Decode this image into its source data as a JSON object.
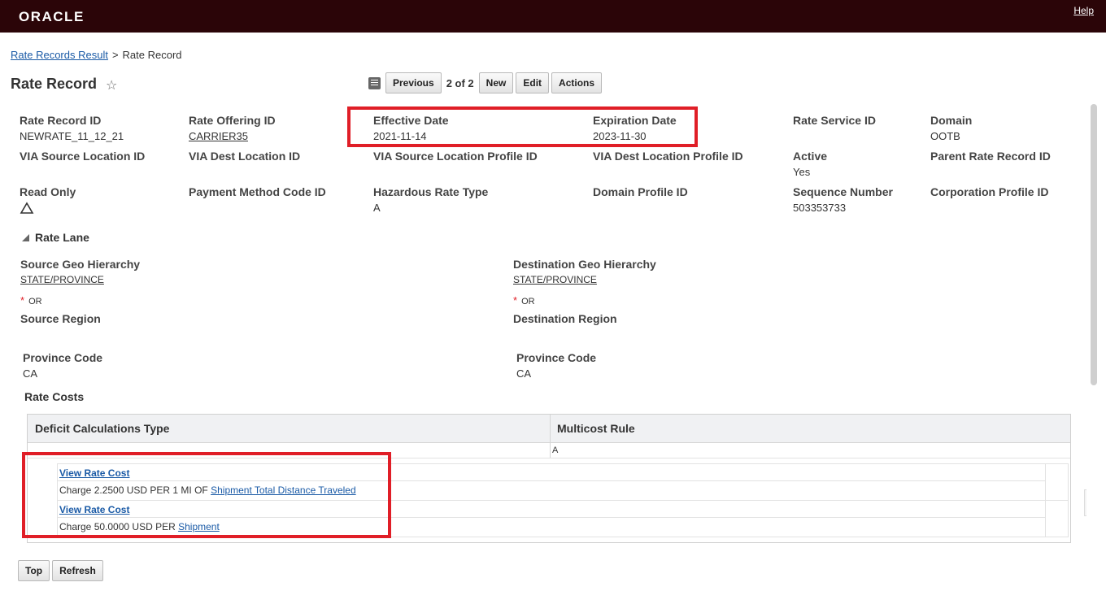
{
  "header": {
    "logo": "ORACLE",
    "help": "Help"
  },
  "breadcrumb": {
    "link": "Rate Records Result",
    "separator": ">",
    "current": "Rate Record"
  },
  "page": {
    "title": "Rate Record",
    "star": "☆"
  },
  "toolbar": {
    "previous": "Previous",
    "count": "2 of 2",
    "new": "New",
    "edit": "Edit",
    "actions": "Actions"
  },
  "fields": {
    "rate_record_id": {
      "label": "Rate Record ID",
      "value": "NEWRATE_11_12_21"
    },
    "rate_offering_id": {
      "label": "Rate Offering ID",
      "value": "CARRIER35"
    },
    "effective_date": {
      "label": "Effective Date",
      "value": "2021-11-14"
    },
    "expiration_date": {
      "label": "Expiration Date",
      "value": "2023-11-30"
    },
    "rate_service_id": {
      "label": "Rate Service ID",
      "value": ""
    },
    "domain": {
      "label": "Domain",
      "value": "OOTB"
    },
    "via_source_location_id": {
      "label": "VIA Source Location ID",
      "value": ""
    },
    "via_dest_location_id": {
      "label": "VIA Dest Location ID",
      "value": ""
    },
    "via_source_location_profile_id": {
      "label": "VIA Source Location Profile ID",
      "value": ""
    },
    "via_dest_location_profile_id": {
      "label": "VIA Dest Location Profile ID",
      "value": ""
    },
    "active": {
      "label": "Active",
      "value": "Yes"
    },
    "parent_rate_record_id": {
      "label": "Parent Rate Record ID",
      "value": ""
    },
    "read_only": {
      "label": "Read Only",
      "value": "",
      "icon": "triangle-outline-icon"
    },
    "payment_method_code_id": {
      "label": "Payment Method Code ID",
      "value": ""
    },
    "hazardous_rate_type": {
      "label": "Hazardous Rate Type",
      "value": "A"
    },
    "domain_profile_id": {
      "label": "Domain Profile ID",
      "value": ""
    },
    "sequence_number": {
      "label": "Sequence Number",
      "value": "503353733"
    },
    "corporation_profile_id": {
      "label": "Corporation Profile ID",
      "value": ""
    }
  },
  "rate_lane": {
    "title": "Rate Lane",
    "source_geo_hierarchy": {
      "label": "Source Geo Hierarchy",
      "value": "STATE/PROVINCE"
    },
    "destination_geo_hierarchy": {
      "label": "Destination Geo Hierarchy",
      "value": "STATE/PROVINCE"
    },
    "or_text": "OR",
    "source_region": {
      "label": "Source Region"
    },
    "destination_region": {
      "label": "Destination Region"
    },
    "source_province_code": {
      "label": "Province Code",
      "value": "CA"
    },
    "destination_province_code": {
      "label": "Province Code",
      "value": "CA"
    }
  },
  "rate_costs": {
    "title": "Rate Costs",
    "columns": [
      "Deficit Calculations Type",
      "Multicost Rule"
    ],
    "row": {
      "deficit": "",
      "multicost": "A"
    },
    "costs": [
      {
        "view_label": "View Rate Cost",
        "charge_text": "Charge 2.2500 USD PER 1 MI OF",
        "charge_link": "Shipment Total Distance Traveled"
      },
      {
        "view_label": "View Rate Cost",
        "charge_text": "Charge 50.0000 USD PER",
        "charge_link": "Shipment"
      }
    ]
  },
  "bottom": {
    "top": "Top",
    "refresh": "Refresh"
  },
  "colors": {
    "header_bg": "#2b0508",
    "highlight": "#e01e27",
    "link": "#1a5aa6"
  }
}
